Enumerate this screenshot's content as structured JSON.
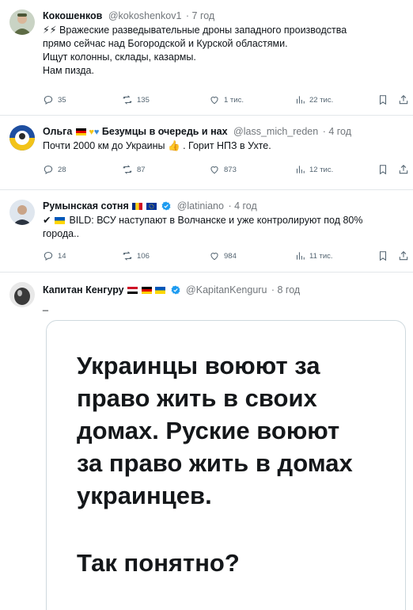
{
  "tweets": [
    {
      "author": "Кокошенков",
      "handle": "@kokoshenkov1",
      "time": "· 7 год",
      "lines": [
        "⚡⚡ Вражеские разведывательные дроны западного производства",
        "прямо сейчас над Богородской и Курской областями.",
        "Ищут колонны, склады, казармы.",
        "Нам пизда."
      ],
      "replies": "35",
      "retweets": "135",
      "likes": "1 тис.",
      "views": "22 тис."
    },
    {
      "author": "Ольга",
      "author_suffix": "Безумцы в очередь и нах",
      "handle": "@lass_mich_reden",
      "time": "· 4 год",
      "lines": [
        "Почти 2000 км до Украины",
        ". Горит НПЗ в Ухте."
      ],
      "thumb_emoji": "👍",
      "replies": "28",
      "retweets": "87",
      "likes": "873",
      "views": "12 тис."
    },
    {
      "author": "Румынская сотня",
      "handle": "@latiniano",
      "time": "· 4 год",
      "lines": [
        "BILD: ВСУ наступают в Волчанске и уже контролируют под 80%",
        "города.."
      ],
      "check_emoji": "✔",
      "replies": "14",
      "retweets": "106",
      "likes": "984",
      "views": "11 тис."
    },
    {
      "author": "Капитан Кенгуру",
      "handle": "@KapitanKenguru",
      "time": "· 8 год",
      "lines": [
        "_"
      ],
      "card_lines": [
        "Украинцы воюют за",
        "право жить в своих",
        "домах. Руские воюют",
        "за право жить в домах",
        "украинцев."
      ],
      "card_question": "Так понятно?"
    }
  ],
  "colors": {
    "text": "#0f1419",
    "muted": "#536471",
    "verified": "#1d9bf0",
    "border": "#e3e7ea"
  }
}
